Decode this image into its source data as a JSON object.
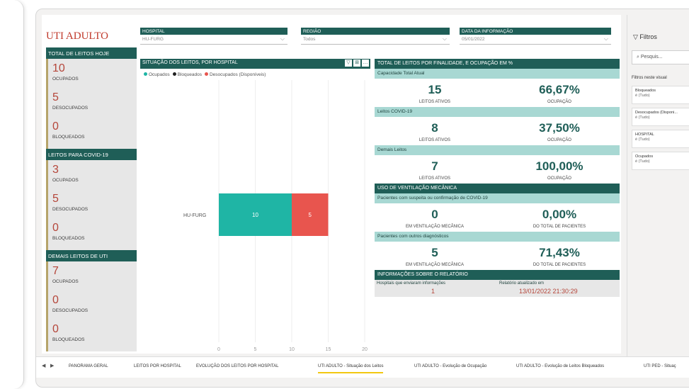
{
  "page_title": "UTI ADULTO",
  "filters": {
    "hospital": {
      "label": "HOSPITAL",
      "value": "HU-FURG"
    },
    "regiao": {
      "label": "REGIÃO",
      "value": "Todos"
    },
    "data": {
      "label": "DATA DA INFORMAÇÃO",
      "value": "05/01/2022"
    }
  },
  "left_sections": [
    {
      "title": "TOTAL DE LEITOS HOJE",
      "stats": [
        {
          "value": "10",
          "label": "OCUPADOS"
        },
        {
          "value": "5",
          "label": "DESOCUPADOS"
        },
        {
          "value": "0",
          "label": "BLOQUEADOS"
        }
      ]
    },
    {
      "title": "LEITOS PARA COVID-19",
      "stats": [
        {
          "value": "3",
          "label": "OCUPADOS"
        },
        {
          "value": "5",
          "label": "DESOCUPADOS"
        },
        {
          "value": "0",
          "label": "BLOQUEADOS"
        }
      ]
    },
    {
      "title": "DEMAIS LEITOS DE UTI",
      "stats": [
        {
          "value": "7",
          "label": "OCUPADOS"
        },
        {
          "value": "0",
          "label": "DESOCUPADOS"
        },
        {
          "value": "0",
          "label": "BLOQUEADOS"
        }
      ]
    }
  ],
  "chart_title": "SITUAÇÃO DOS LEITOS, POR HOSPITAL",
  "chart_tools": [
    "▽",
    "⊞",
    "…"
  ],
  "chart_data": {
    "type": "bar",
    "orientation": "horizontal",
    "stacked": true,
    "categories": [
      "HU-FURG"
    ],
    "series": [
      {
        "name": "Ocupados",
        "values": [
          10
        ],
        "color": "#1fb5a5"
      },
      {
        "name": "Bloqueados",
        "values": [
          0
        ],
        "color": "#222222"
      },
      {
        "name": "Desocupados (Disponíveis)",
        "values": [
          5
        ],
        "color": "#e8554e"
      }
    ],
    "xticks": [
      0,
      5,
      10,
      15,
      20
    ],
    "xlim": [
      0,
      20
    ],
    "grid": true,
    "legend_position": "top-left"
  },
  "right_panel": {
    "header": "TOTAL DE LEITOS POR FINALIDADE, E OCUPAÇÃO EM %",
    "groups": [
      {
        "sub": "Capacidade Total Atual",
        "left_value": "15",
        "left_caption": "LEITOS ATIVOS",
        "right_value": "66,67%",
        "right_caption": "OCUPAÇÃO"
      },
      {
        "sub": "Leitos COVID-19",
        "left_value": "8",
        "left_caption": "LEITOS ATIVOS",
        "right_value": "37,50%",
        "right_caption": "OCUPAÇÃO"
      },
      {
        "sub": "Demais Leitos",
        "left_value": "7",
        "left_caption": "LEITOS ATIVOS",
        "right_value": "100,00%",
        "right_caption": "OCUPAÇÃO"
      }
    ],
    "vent_header": "USO DE VENTILAÇÃO MECÂNICA",
    "vent_groups": [
      {
        "sub": "Pacientes com suspeita ou confirmação de COVID-19",
        "left_value": "0",
        "left_caption": "EM VENTILAÇÃO MECÂNICA",
        "right_value": "0,00%",
        "right_caption": "DO TOTAL DE PACIENTES"
      },
      {
        "sub": "Pacientes com outros diagnósticos",
        "left_value": "5",
        "left_caption": "EM VENTILAÇÃO MECÂNICA",
        "right_value": "71,43%",
        "right_caption": "DO TOTAL DE PACIENTES"
      }
    ],
    "info_header": "INFORMAÇÕES SOBRE O RELATÓRIO",
    "info": {
      "hospitals_label": "Hospitais que enviaram informações",
      "hospitals_value": "1",
      "updated_label": "Relatório atualizado em",
      "updated_value": "13/01/2022 21:30:29"
    }
  },
  "filter_pane": {
    "title": "Filtros",
    "search_placeholder": "Pesquis...",
    "section": "Filtros neste visual",
    "cards": [
      {
        "name": "Bloqueados",
        "value": "é (Tudo)"
      },
      {
        "name": "Desocupados (Disponi...",
        "value": "é (Tudo)"
      },
      {
        "name": "HOSPITAL",
        "value": "é (Tudo)"
      },
      {
        "name": "Ocupados",
        "value": "é (Tudo)"
      }
    ]
  },
  "tabs": [
    "PANORAMA GERAL",
    "LEITOS POR HOSPITAL",
    "EVOLUÇÃO DOS LEITOS POR HOSPITAL",
    "UTI ADULTO - Situação dos Leitos",
    "UTI ADULTO - Evolução de Ocupação",
    "UTI ADULTO - Evolução de Leitos Bloqueados",
    "UTI PED - Situaç"
  ],
  "active_tab": 3,
  "colors": {
    "primary": "#1f5e57",
    "accent": "#a8d8d3",
    "title_red": "#c0392b",
    "tab_highlight": "#f2c811"
  }
}
